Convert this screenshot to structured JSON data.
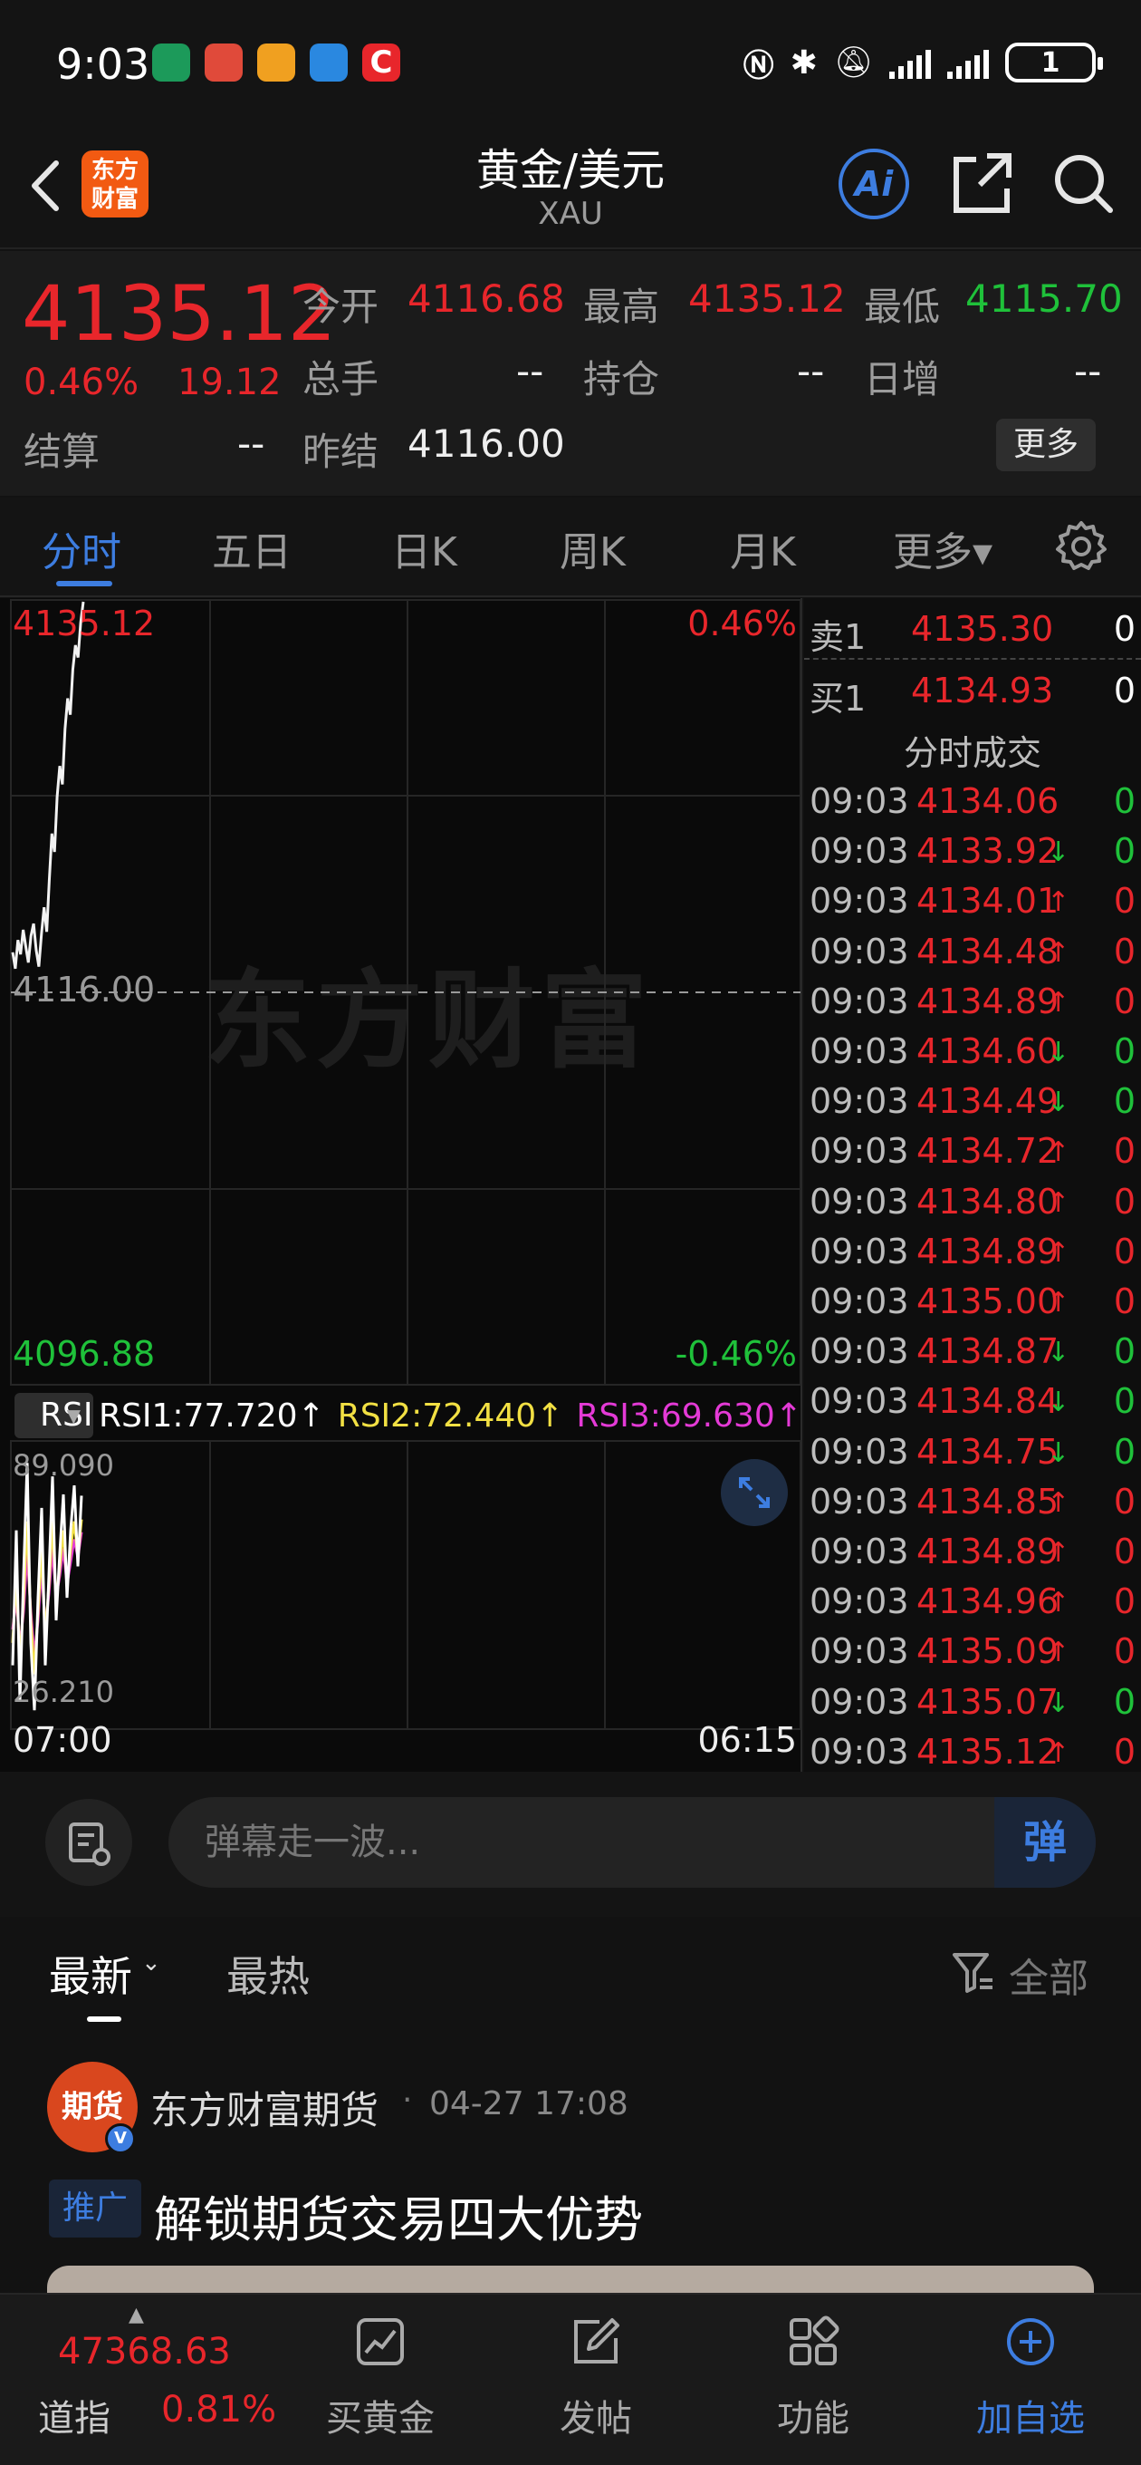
{
  "status_bar": {
    "time": "9:03",
    "battery": "1"
  },
  "header": {
    "logo_text": "东方财富",
    "title": "黄金/美元",
    "subtitle": "XAU",
    "ai_label": "Ai"
  },
  "quote": {
    "last_price": "4135.12",
    "change_pct": "0.46%",
    "change_val": "19.12",
    "open_label": "今开",
    "open": "4116.68",
    "high_label": "最高",
    "high": "4135.12",
    "low_label": "最低",
    "low": "4115.70",
    "volume_label": "总手",
    "volume": "--",
    "oi_label": "持仓",
    "oi": "--",
    "daily_inc_label": "日增",
    "daily_inc": "--",
    "settle_label": "结算",
    "settle": "--",
    "prev_settle_label": "昨结",
    "prev_settle": "4116.00",
    "more_label": "更多"
  },
  "tabs": [
    "分时",
    "五日",
    "日K",
    "周K",
    "月K",
    "更多▾"
  ],
  "chart": {
    "watermark": "东方财富",
    "top_price": "4135.12",
    "top_pct": "0.46%",
    "mid_price": "4116.00",
    "bottom_price": "4096.88",
    "bottom_pct": "-0.46%",
    "rsi_select": "RSI",
    "rsi1": "RSI1:77.720↑",
    "rsi2": "RSI2:72.440↑",
    "rsi3": "RSI3:69.630↑",
    "rsi_top": "89.090",
    "rsi_bottom": "26.210",
    "time_start": "07:00",
    "time_end": "06:15",
    "colors": {
      "up": "#e8262b",
      "down": "#1fc13a",
      "rsi1": "#ffffff",
      "rsi2": "#f2e043",
      "rsi3": "#e43ad6"
    }
  },
  "chart_data": {
    "type": "line",
    "title": "",
    "xlabel": "",
    "ylabel": "",
    "ylim": [
      4096.88,
      4135.12
    ],
    "x_range": [
      "07:00",
      "06:15"
    ],
    "series": [
      {
        "values": [
          4118.0,
          4117.2,
          4118.6,
          4117.9,
          4119.1,
          4118.3,
          4117.5,
          4118.8,
          4119.4,
          4118.1,
          4117.3,
          4118.9,
          4120.2,
          4119.0,
          4121.5,
          4123.8,
          4122.9,
          4125.6,
          4127.1,
          4126.2,
          4128.9,
          4130.4,
          4129.6,
          4131.8,
          4133.0,
          4132.4,
          4134.1,
          4135.12
        ]
      }
    ],
    "rsi": {
      "ylim": [
        26.21,
        89.09
      ],
      "series": [
        {
          "name": "RSI1",
          "values": [
            40,
            70,
            32,
            60,
            85,
            45,
            30,
            55,
            75,
            40,
            60,
            82,
            50,
            65,
            78,
            55,
            70,
            80,
            62,
            77.72
          ]
        },
        {
          "name": "RSI2",
          "values": [
            45,
            60,
            40,
            55,
            72,
            50,
            38,
            52,
            66,
            46,
            58,
            72,
            54,
            62,
            70,
            58,
            66,
            72,
            64,
            72.44
          ]
        },
        {
          "name": "RSI3",
          "values": [
            48,
            55,
            44,
            52,
            65,
            52,
            42,
            50,
            62,
            48,
            56,
            66,
            55,
            60,
            66,
            58,
            63,
            68,
            64,
            69.63
          ]
        }
      ]
    }
  },
  "book": {
    "ask_label": "卖1",
    "ask_price": "4135.30",
    "ask_vol": "0",
    "bid_label": "买1",
    "bid_price": "4134.93",
    "bid_vol": "0",
    "ticks_title": "分时成交",
    "ticks": [
      {
        "time": "09:03",
        "price": "4134.06",
        "dir": "",
        "vol": "0",
        "color": "#e8262b",
        "vol_color": "#1fc13a"
      },
      {
        "time": "09:03",
        "price": "4133.92",
        "dir": "↓",
        "vol": "0",
        "color": "#e8262b",
        "vol_color": "#1fc13a"
      },
      {
        "time": "09:03",
        "price": "4134.01",
        "dir": "↑",
        "vol": "0",
        "color": "#e8262b",
        "vol_color": "#e8262b"
      },
      {
        "time": "09:03",
        "price": "4134.48",
        "dir": "↑",
        "vol": "0",
        "color": "#e8262b",
        "vol_color": "#e8262b"
      },
      {
        "time": "09:03",
        "price": "4134.89",
        "dir": "↑",
        "vol": "0",
        "color": "#e8262b",
        "vol_color": "#e8262b"
      },
      {
        "time": "09:03",
        "price": "4134.60",
        "dir": "↓",
        "vol": "0",
        "color": "#e8262b",
        "vol_color": "#1fc13a"
      },
      {
        "time": "09:03",
        "price": "4134.49",
        "dir": "↓",
        "vol": "0",
        "color": "#e8262b",
        "vol_color": "#1fc13a"
      },
      {
        "time": "09:03",
        "price": "4134.72",
        "dir": "↑",
        "vol": "0",
        "color": "#e8262b",
        "vol_color": "#e8262b"
      },
      {
        "time": "09:03",
        "price": "4134.80",
        "dir": "↑",
        "vol": "0",
        "color": "#e8262b",
        "vol_color": "#e8262b"
      },
      {
        "time": "09:03",
        "price": "4134.89",
        "dir": "↑",
        "vol": "0",
        "color": "#e8262b",
        "vol_color": "#e8262b"
      },
      {
        "time": "09:03",
        "price": "4135.00",
        "dir": "↑",
        "vol": "0",
        "color": "#e8262b",
        "vol_color": "#e8262b"
      },
      {
        "time": "09:03",
        "price": "4134.87",
        "dir": "↓",
        "vol": "0",
        "color": "#e8262b",
        "vol_color": "#1fc13a"
      },
      {
        "time": "09:03",
        "price": "4134.84",
        "dir": "↓",
        "vol": "0",
        "color": "#e8262b",
        "vol_color": "#1fc13a"
      },
      {
        "time": "09:03",
        "price": "4134.75",
        "dir": "↓",
        "vol": "0",
        "color": "#e8262b",
        "vol_color": "#1fc13a"
      },
      {
        "time": "09:03",
        "price": "4134.85",
        "dir": "↑",
        "vol": "0",
        "color": "#e8262b",
        "vol_color": "#e8262b"
      },
      {
        "time": "09:03",
        "price": "4134.89",
        "dir": "↑",
        "vol": "0",
        "color": "#e8262b",
        "vol_color": "#e8262b"
      },
      {
        "time": "09:03",
        "price": "4134.96",
        "dir": "↑",
        "vol": "0",
        "color": "#e8262b",
        "vol_color": "#e8262b"
      },
      {
        "time": "09:03",
        "price": "4135.09",
        "dir": "↑",
        "vol": "0",
        "color": "#e8262b",
        "vol_color": "#e8262b"
      },
      {
        "time": "09:03",
        "price": "4135.07",
        "dir": "↓",
        "vol": "0",
        "color": "#e8262b",
        "vol_color": "#1fc13a"
      },
      {
        "time": "09:03",
        "price": "4135.12",
        "dir": "↑",
        "vol": "0",
        "color": "#e8262b",
        "vol_color": "#e8262b"
      }
    ]
  },
  "danmu": {
    "placeholder": "弹幕走一波...",
    "send_label": "弹"
  },
  "feed": {
    "tab_new": "最新",
    "tab_hot": "最热",
    "filter_label": "全部",
    "post": {
      "avatar_text": "期货",
      "author": "东方财富期货",
      "time": "04-27 17:08",
      "tag": "推广",
      "title": "解锁期货交易四大优势"
    }
  },
  "bottom_nav": {
    "index_value": "47368.63",
    "index_name": "道指",
    "index_pct": "0.81%",
    "items": [
      {
        "label": "买黄金",
        "icon": "chart-icon"
      },
      {
        "label": "发帖",
        "icon": "edit-icon"
      },
      {
        "label": "功能",
        "icon": "grid-icon"
      },
      {
        "label": "加自选",
        "icon": "add-circle-icon"
      }
    ]
  }
}
